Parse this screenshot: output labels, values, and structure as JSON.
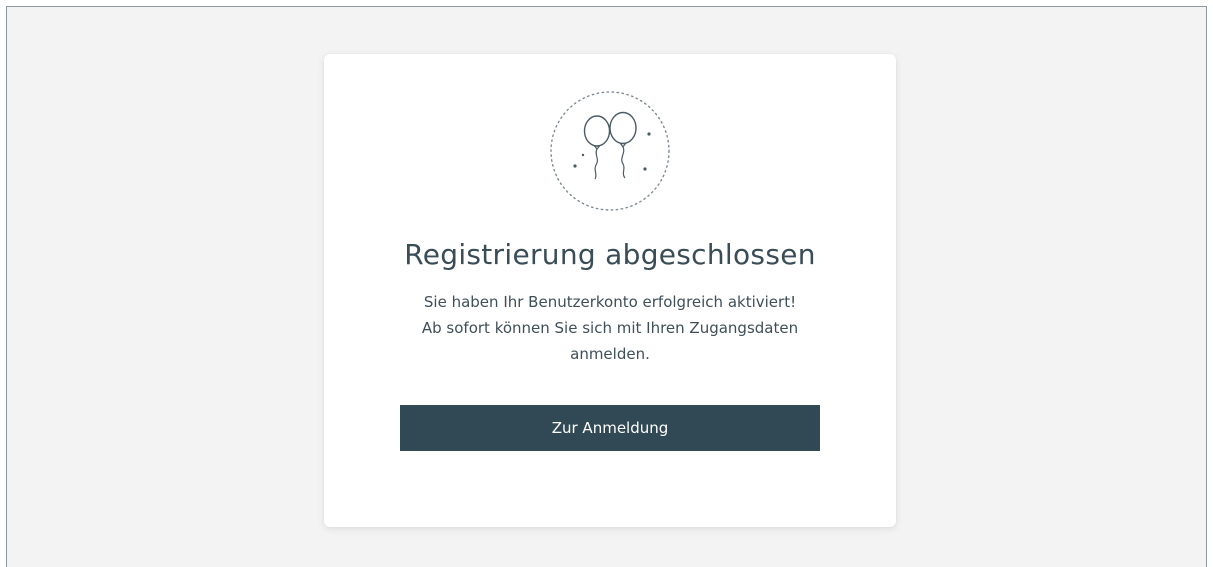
{
  "card": {
    "title": "Registrierung abgeschlossen",
    "message_lines": [
      "Sie haben Ihr Benutzerkonto erfolgreich aktiviert!",
      "Ab sofort können Sie sich mit Ihren Zugangsdaten",
      "anmelden."
    ],
    "button_label": "Zur Anmeldung"
  },
  "icons": {
    "illustration": "balloons-icon"
  },
  "colors": {
    "page_background": "#f3f3f3",
    "card_background": "#ffffff",
    "button_background": "#314954",
    "button_text": "#ffffff",
    "heading_text": "#3a4d57"
  }
}
